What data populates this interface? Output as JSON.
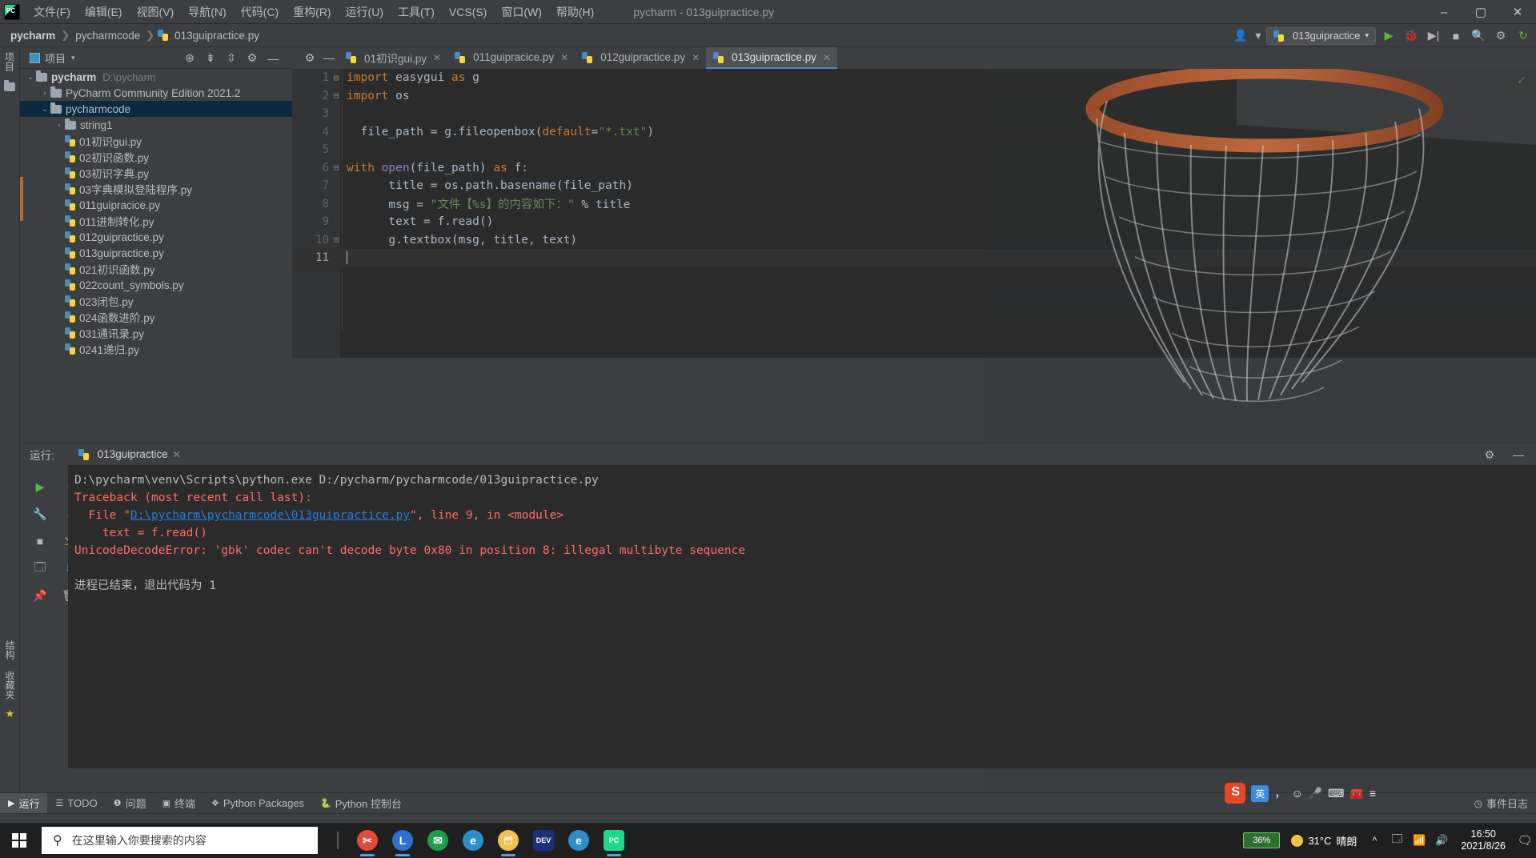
{
  "window": {
    "title": "pycharm - 013guipractice.py",
    "minimize": "–",
    "maximize": "▢",
    "close": "✕"
  },
  "menubar": {
    "items": [
      {
        "label": "文件(F)",
        "name": "menu-file"
      },
      {
        "label": "编辑(E)",
        "name": "menu-edit"
      },
      {
        "label": "视图(V)",
        "name": "menu-view"
      },
      {
        "label": "导航(N)",
        "name": "menu-navigate"
      },
      {
        "label": "代码(C)",
        "name": "menu-code"
      },
      {
        "label": "重构(R)",
        "name": "menu-refactor"
      },
      {
        "label": "运行(U)",
        "name": "menu-run"
      },
      {
        "label": "工具(T)",
        "name": "menu-tools"
      },
      {
        "label": "VCS(S)",
        "name": "menu-vcs"
      },
      {
        "label": "窗口(W)",
        "name": "menu-window"
      },
      {
        "label": "帮助(H)",
        "name": "menu-help"
      }
    ]
  },
  "breadcrumb": {
    "project": "pycharm",
    "folder": "pycharmcode",
    "file": "013guipractice.py",
    "separator": "❯"
  },
  "toolbar": {
    "run_config": "013guipractice",
    "run_config_caret": "▾",
    "account_icon": "👤",
    "account_caret": "▾",
    "run_icon": "▶",
    "debug_icon": "🐞",
    "coverage_icon": "▶|",
    "stop_icon": "■",
    "search_icon": "🔍",
    "settings_icon": "⚙",
    "updates_icon": "↻"
  },
  "project_panel": {
    "title": "项目",
    "caret": "▾",
    "tool_icons": [
      "⊕",
      "⇟",
      "⇳",
      "⚙",
      "—"
    ],
    "left_strip_label": "项目",
    "tree": [
      {
        "depth": 0,
        "arrow": "⌄",
        "type": "folder",
        "name": "pycharm",
        "path": "D:\\pycharm",
        "bold": true,
        "selected": false
      },
      {
        "depth": 1,
        "arrow": "›",
        "type": "folder",
        "name": "PyCharm Community Edition 2021.2",
        "path": "",
        "bold": false,
        "selected": false
      },
      {
        "depth": 1,
        "arrow": "⌄",
        "type": "folder",
        "name": "pycharmcode",
        "path": "",
        "bold": false,
        "selected": true
      },
      {
        "depth": 2,
        "arrow": "›",
        "type": "folder",
        "name": "string1",
        "path": "",
        "bold": false,
        "selected": false
      },
      {
        "depth": 2,
        "arrow": "",
        "type": "py",
        "name": "01初识gui.py",
        "path": "",
        "bold": false,
        "selected": false
      },
      {
        "depth": 2,
        "arrow": "",
        "type": "py",
        "name": "02初识函数.py",
        "path": "",
        "bold": false,
        "selected": false
      },
      {
        "depth": 2,
        "arrow": "",
        "type": "py",
        "name": "03初识字典.py",
        "path": "",
        "bold": false,
        "selected": false
      },
      {
        "depth": 2,
        "arrow": "",
        "type": "py",
        "name": "03字典模拟登陆程序.py",
        "path": "",
        "bold": false,
        "selected": false
      },
      {
        "depth": 2,
        "arrow": "",
        "type": "py",
        "name": "011guipracice.py",
        "path": "",
        "bold": false,
        "selected": false
      },
      {
        "depth": 2,
        "arrow": "",
        "type": "py",
        "name": "011进制转化.py",
        "path": "",
        "bold": false,
        "selected": false
      },
      {
        "depth": 2,
        "arrow": "",
        "type": "py",
        "name": "012guipractice.py",
        "path": "",
        "bold": false,
        "selected": false
      },
      {
        "depth": 2,
        "arrow": "",
        "type": "py",
        "name": "013guipractice.py",
        "path": "",
        "bold": false,
        "selected": false
      },
      {
        "depth": 2,
        "arrow": "",
        "type": "py",
        "name": "021初识函数.py",
        "path": "",
        "bold": false,
        "selected": false
      },
      {
        "depth": 2,
        "arrow": "",
        "type": "py",
        "name": "022count_symbols.py",
        "path": "",
        "bold": false,
        "selected": false
      },
      {
        "depth": 2,
        "arrow": "",
        "type": "py",
        "name": "023闭包.py",
        "path": "",
        "bold": false,
        "selected": false
      },
      {
        "depth": 2,
        "arrow": "",
        "type": "py",
        "name": "024函数进阶.py",
        "path": "",
        "bold": false,
        "selected": false
      },
      {
        "depth": 2,
        "arrow": "",
        "type": "py",
        "name": "031通讯录.py",
        "path": "",
        "bold": false,
        "selected": false
      },
      {
        "depth": 2,
        "arrow": "",
        "type": "py",
        "name": "0241递归.py",
        "path": "",
        "bold": false,
        "selected": false
      }
    ]
  },
  "editor": {
    "tabs": [
      {
        "label": "01初识gui.py",
        "active": false
      },
      {
        "label": "011guipracice.py",
        "active": false
      },
      {
        "label": "012guipractice.py",
        "active": false
      },
      {
        "label": "013guipractice.py",
        "active": true
      }
    ],
    "close_glyph": "✕",
    "inspection_ok": "✓",
    "current_line": 11,
    "lines": [
      {
        "n": 1,
        "fold": "⊟",
        "tokens": [
          {
            "t": "import",
            "c": "kw"
          },
          {
            "t": " easygui ",
            "c": "nm"
          },
          {
            "t": "as",
            "c": "kw"
          },
          {
            "t": " g",
            "c": "nm"
          }
        ]
      },
      {
        "n": 2,
        "fold": "⊟",
        "tokens": [
          {
            "t": "import",
            "c": "kw"
          },
          {
            "t": " os",
            "c": "nm"
          }
        ]
      },
      {
        "n": 3,
        "fold": "",
        "tokens": []
      },
      {
        "n": 4,
        "fold": "",
        "tokens": [
          {
            "t": "  file_path = g.fileopenbox(",
            "c": "nm"
          },
          {
            "t": "default",
            "c": "kw"
          },
          {
            "t": "=",
            "c": "nm"
          },
          {
            "t": "\"*.txt\"",
            "c": "str"
          },
          {
            "t": ")",
            "c": "nm"
          }
        ]
      },
      {
        "n": 5,
        "fold": "",
        "tokens": []
      },
      {
        "n": 6,
        "fold": "⊟",
        "tokens": [
          {
            "t": "with",
            "c": "kw"
          },
          {
            "t": " ",
            "c": "nm"
          },
          {
            "t": "open",
            "c": "bi"
          },
          {
            "t": "(file_path) ",
            "c": "nm"
          },
          {
            "t": "as",
            "c": "kw"
          },
          {
            "t": " f:",
            "c": "nm"
          }
        ]
      },
      {
        "n": 7,
        "fold": "",
        "tokens": [
          {
            "t": "      title = os.path.basename(file_path)",
            "c": "nm"
          }
        ]
      },
      {
        "n": 8,
        "fold": "",
        "tokens": [
          {
            "t": "      msg = ",
            "c": "nm"
          },
          {
            "t": "\"文件【%s】的内容如下：\"",
            "c": "str"
          },
          {
            "t": " % title",
            "c": "nm"
          }
        ]
      },
      {
        "n": 9,
        "fold": "",
        "tokens": [
          {
            "t": "      text = f.read()",
            "c": "nm"
          }
        ]
      },
      {
        "n": 10,
        "fold": "⊡",
        "tokens": [
          {
            "t": "      g.textbox(msg, title, text)",
            "c": "nm"
          }
        ]
      },
      {
        "n": 11,
        "fold": "",
        "tokens": []
      }
    ]
  },
  "run_window": {
    "label": "运行:",
    "tab": "013guipractice",
    "tab_close": "✕",
    "settings_icon": "⚙",
    "minimize_icon": "—",
    "side_icons": [
      "▶",
      "🔧",
      "■",
      "🗔",
      "📌"
    ],
    "side_icons2": [
      "↑",
      "↓",
      "⇲",
      "⇩",
      "🗑"
    ],
    "console": [
      {
        "text": "D:\\pycharm\\venv\\Scripts\\python.exe D:/pycharm/pycharmcode/013guipractice.py",
        "style": "plain"
      },
      {
        "text": "Traceback (most recent call last):",
        "style": "err"
      },
      {
        "segments": [
          {
            "t": "  File \"",
            "s": "err"
          },
          {
            "t": "D:\\pycharm\\pycharmcode\\013guipractice.py",
            "s": "link"
          },
          {
            "t": "\", line 9, in <module>",
            "s": "err"
          }
        ],
        "style": "mixed"
      },
      {
        "text": "    text = f.read()",
        "style": "err"
      },
      {
        "text": "UnicodeDecodeError: 'gbk' codec can't decode byte 0x80 in position 8: illegal multibyte sequence",
        "style": "err"
      },
      {
        "text": "",
        "style": "plain"
      },
      {
        "text": "进程已结束，退出代码为 1",
        "style": "plain"
      }
    ]
  },
  "bottom_strip": {
    "items": [
      {
        "label": "运行",
        "icon": "▶",
        "active": true,
        "name": "tool-run"
      },
      {
        "label": "TODO",
        "icon": "☰",
        "active": false,
        "name": "tool-todo"
      },
      {
        "label": "问题",
        "icon": "❶",
        "active": false,
        "name": "tool-problems"
      },
      {
        "label": "终端",
        "icon": "▣",
        "active": false,
        "name": "tool-terminal"
      },
      {
        "label": "Python Packages",
        "icon": "❖",
        "active": false,
        "name": "tool-python-packages"
      },
      {
        "label": "Python 控制台",
        "icon": "🐍",
        "active": false,
        "name": "tool-python-console"
      }
    ],
    "event_log": "事件日志",
    "event_log_icon": "◷"
  },
  "left_strip": {
    "labels": [
      "结构",
      "收藏夹"
    ],
    "star_icon": "★"
  },
  "taskbar": {
    "search_placeholder": "在这里输入你要搜索的内容",
    "search_icon": "🔎",
    "apps": [
      {
        "name": "taskbar-snip-app",
        "glyph": "✂",
        "color": "#e14b3b",
        "running": true
      },
      {
        "name": "taskbar-loop-app",
        "glyph": "L",
        "color": "#2f6fd0",
        "running": true
      },
      {
        "name": "taskbar-mail-app",
        "glyph": "✉",
        "color": "#1e9e4a",
        "running": false
      },
      {
        "name": "taskbar-edge-app",
        "glyph": "e",
        "color": "#2d8ec9",
        "running": false
      },
      {
        "name": "taskbar-explorer-app",
        "glyph": "🗂",
        "color": "#f1c152",
        "running": true
      },
      {
        "name": "taskbar-devcpp-app",
        "glyph": "DEV",
        "color": "#1c2f7a",
        "running": false
      },
      {
        "name": "taskbar-edge2-app",
        "glyph": "e",
        "color": "#2d8ec9",
        "running": false
      },
      {
        "name": "taskbar-pycharm-app",
        "glyph": "PC",
        "color": "#21d789",
        "running": true
      }
    ],
    "battery_percent": "36%",
    "weather_temp": "31°C",
    "weather_desc": "晴朗",
    "tray_icons": [
      "^",
      "🗔",
      "🔊",
      "📶"
    ],
    "clock_time": "16:50",
    "clock_date": "2021/8/26",
    "notification_icon": "🗨"
  },
  "ime": {
    "lang": "英",
    "punct": "，",
    "emoji": "☺",
    "mic": "🎤",
    "keyboard": "⌨",
    "toolbox": "🧰",
    "more": "≡"
  },
  "colors": {
    "ide_chrome": "#3c3f41",
    "editor_bg": "#2b2b2b",
    "accent_blue": "#4a88c7",
    "selection": "#0d293e",
    "keyword_orange": "#cc7832",
    "string_green": "#6a8759",
    "error_red": "#ff6b68",
    "link_blue": "#287bde"
  }
}
